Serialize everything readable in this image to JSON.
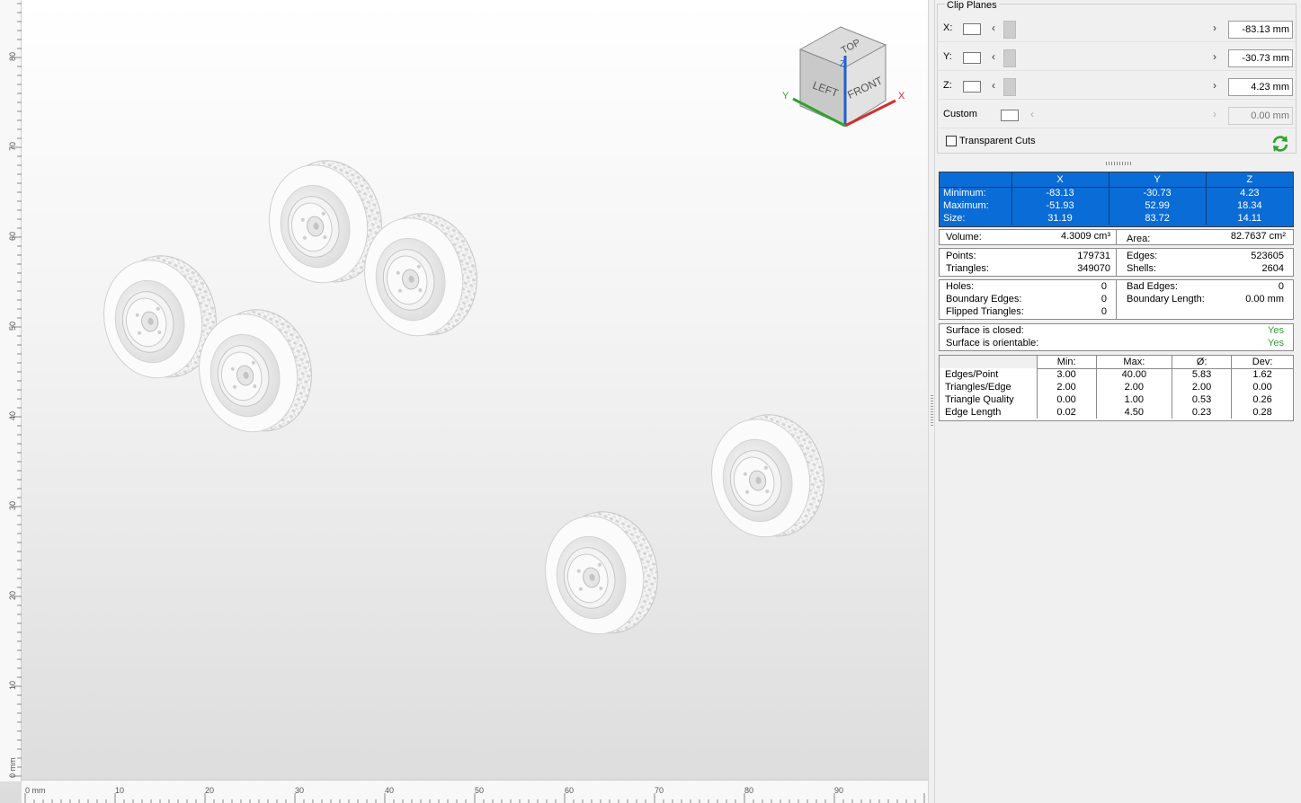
{
  "viewport": {
    "ruler_h": [
      "0 mm",
      "10",
      "20",
      "30",
      "40",
      "50",
      "60",
      "70",
      "80",
      "90"
    ],
    "ruler_v": [
      "80",
      "70",
      "60",
      "50",
      "40",
      "30",
      "20",
      "10",
      "0 mm"
    ],
    "view_cube": {
      "top": "TOP",
      "left": "LEFT",
      "front": "FRONT",
      "axis_x": "X",
      "axis_y": "Y",
      "axis_z": "Z"
    }
  },
  "clip_planes": {
    "title": "Clip Planes",
    "rows": [
      {
        "label": "X:",
        "value": "-83.13 mm"
      },
      {
        "label": "Y:",
        "value": "-30.73 mm"
      },
      {
        "label": "Z:",
        "value": "4.23 mm"
      },
      {
        "label": "Custom",
        "value": "0.00 mm"
      }
    ],
    "transparent_cuts": "Transparent Cuts"
  },
  "bounding_box": {
    "headers": [
      "",
      "X",
      "Y",
      "Z"
    ],
    "rows": [
      [
        "Minimum:",
        "-83.13",
        "-30.73",
        "4.23"
      ],
      [
        "Maximum:",
        "-51.93",
        "52.99",
        "18.34"
      ],
      [
        "Size:",
        "31.19",
        "83.72",
        "14.11"
      ]
    ]
  },
  "volume_area": {
    "volume_label": "Volume:",
    "volume": "4.3009 cm³",
    "area_label": "Area:",
    "area": "82.7637 cm²"
  },
  "counts": {
    "points_label": "Points:",
    "points": "179731",
    "triangles_label": "Triangles:",
    "triangles": "349070",
    "edges_label": "Edges:",
    "edges": "523605",
    "shells_label": "Shells:",
    "shells": "2604"
  },
  "errors": {
    "holes_label": "Holes:",
    "holes": "0",
    "boundary_edges_label": "Boundary Edges:",
    "boundary_edges": "0",
    "flipped_label": "Flipped Triangles:",
    "flipped": "0",
    "bad_edges_label": "Bad Edges:",
    "bad_edges": "0",
    "boundary_length_label": "Boundary Length:",
    "boundary_length": "0.00 mm"
  },
  "surface": {
    "closed_label": "Surface is closed:",
    "closed": "Yes",
    "orientable_label": "Surface is orientable:",
    "orientable": "Yes"
  },
  "metrics": {
    "headers": [
      "",
      "Min:",
      "Max:",
      "Ø:",
      "Dev:"
    ],
    "rows": [
      [
        "Edges/Point",
        "3.00",
        "40.00",
        "5.83",
        "1.62"
      ],
      [
        "Triangles/Edge",
        "2.00",
        "2.00",
        "2.00",
        "0.00"
      ],
      [
        "Triangle Quality",
        "0.00",
        "1.00",
        "0.53",
        "0.26"
      ],
      [
        "Edge Length",
        "0.02",
        "4.50",
        "0.23",
        "0.28"
      ]
    ]
  },
  "colors": {
    "selection_blue": "#0a6cd6",
    "axis_x": "#d03030",
    "axis_y": "#2fa22f",
    "axis_z": "#2060d0",
    "ok_green": "#3c9a3c"
  }
}
